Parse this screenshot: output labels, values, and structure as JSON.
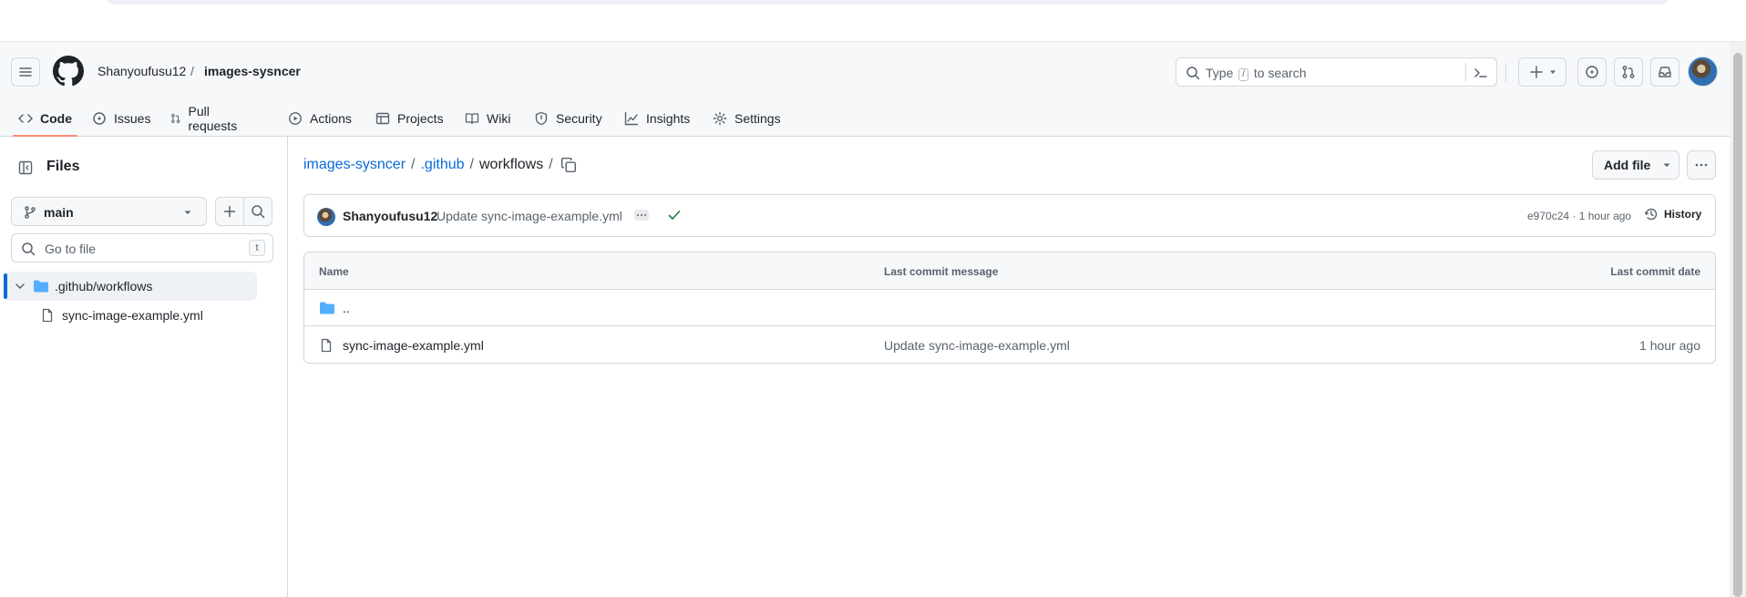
{
  "header": {
    "owner": "Shanyoufusu12",
    "separator": "/",
    "repo": "images-sysncer",
    "search_prefix": "Type",
    "search_key": "/",
    "search_suffix": "to search"
  },
  "tabs": [
    {
      "label": "Code",
      "icon": "code-icon",
      "active": true
    },
    {
      "label": "Issues",
      "icon": "issue-opened-icon"
    },
    {
      "label": "Pull requests",
      "icon": "git-pull-request-icon"
    },
    {
      "label": "Actions",
      "icon": "play-icon"
    },
    {
      "label": "Projects",
      "icon": "table-icon"
    },
    {
      "label": "Wiki",
      "icon": "book-icon"
    },
    {
      "label": "Security",
      "icon": "shield-icon"
    },
    {
      "label": "Insights",
      "icon": "graph-icon"
    },
    {
      "label": "Settings",
      "icon": "gear-icon"
    }
  ],
  "sidebar": {
    "title": "Files",
    "branch": "main",
    "goto_placeholder": "Go to file",
    "goto_key": "t",
    "tree": [
      {
        "label": ".github/workflows",
        "type": "folder",
        "expanded": true,
        "selected": true
      },
      {
        "label": "sync-image-example.yml",
        "type": "file"
      }
    ]
  },
  "breadcrumb": {
    "repo": "images-sysncer",
    "dir1": ".github",
    "current": "workflows",
    "sep": "/"
  },
  "actions": {
    "add_file": "Add file"
  },
  "commit": {
    "author": "Shanyoufusu12",
    "message": "Update sync-image-example.yml",
    "hash_time": "e970c24 · 1 hour ago",
    "history": "History"
  },
  "table": {
    "headers": [
      "Name",
      "Last commit message",
      "Last commit date"
    ],
    "parent_label": "..",
    "rows": [
      {
        "name": "sync-image-example.yml",
        "message": "Update sync-image-example.yml",
        "date": "1 hour ago"
      }
    ]
  },
  "colors": {
    "accent_link": "#0969da",
    "active_tab_underline": "#fd8c73",
    "success": "#1a7f37",
    "folder": "#54aeff"
  }
}
